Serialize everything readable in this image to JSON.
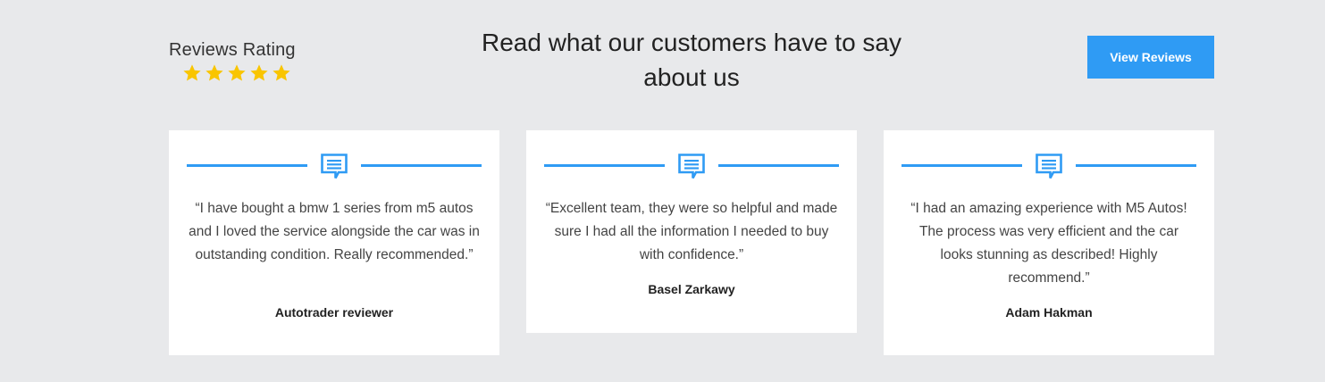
{
  "rating": {
    "label": "Reviews Rating",
    "stars": 5,
    "star_color": "#f9c500",
    "star_icon": "star-icon"
  },
  "headline": "Read what our customers have to say about us",
  "view_button": {
    "label": "View Reviews",
    "color": "#2f9bf4"
  },
  "reviews": [
    {
      "quote": "“I have bought a bmw 1 series from m5 autos and I loved the service alongside the car was in outstanding condition. Really recommended.”",
      "author": "Autotrader reviewer",
      "icon": "chat-icon"
    },
    {
      "quote": "“Excellent team, they were so helpful and made sure I had all the information I needed to buy with confidence.”",
      "author": "Basel Zarkawy",
      "icon": "chat-icon"
    },
    {
      "quote": "“I had an amazing experience with M5 Autos! The process was very efficient and the car looks stunning as described! Highly recommend.”",
      "author": "Adam Hakman",
      "icon": "chat-icon"
    }
  ],
  "accent_color": "#2f9bf4",
  "background_color": "#e8e9eb"
}
